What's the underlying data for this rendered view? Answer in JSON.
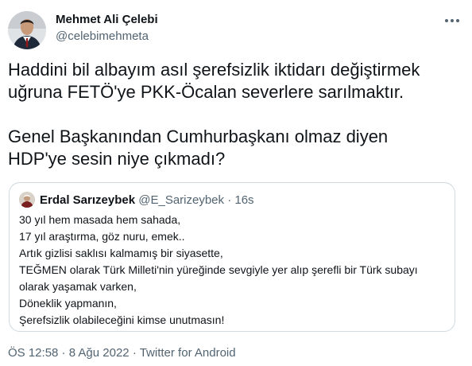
{
  "author": {
    "name": "Mehmet Ali Çelebi",
    "handle": "@celebimehmeta"
  },
  "menu": {
    "icon": "more-horizontal-icon"
  },
  "tweet": {
    "paragraph_1_line_1": "Haddini bil albayım asıl şerefsizlik iktidarı değiştirmek",
    "paragraph_1_line_2": "uğruna FETÖ'ye PKK-Öcalan severlere sarılmaktır.",
    "paragraph_2_line_1": "Genel Başkanından Cumhurbaşkanı olmaz diyen",
    "paragraph_2_line_2": "HDP'ye sesin niye çıkmadı?"
  },
  "quote": {
    "name": "Erdal Sarızeybek",
    "handle": "@E_Sarizeybek",
    "separator": " · ",
    "time": "16s",
    "lines": [
      "30 yıl hem masada hem sahada,",
      "17 yıl araştırma, göz nuru, emek..",
      "Artık gizlisi saklısı kalmamış bir siyasette,",
      "TEĞMEN olarak Türk Milleti'nin yüreğinde sevgiyle yer alıp şerefli bir Türk subayı",
      "olarak yaşamak varken,",
      "Döneklik yapmanın,",
      "Şerefsizlik olabileceğini kimse unutmasın!"
    ]
  },
  "footer": {
    "time": "ÖS 12:58",
    "date": "8 Ağu 2022",
    "source": "Twitter for Android",
    "separator": " · "
  },
  "colors": {
    "text_primary": "#0f1419",
    "text_secondary": "#536471",
    "border": "#cfd9de"
  }
}
